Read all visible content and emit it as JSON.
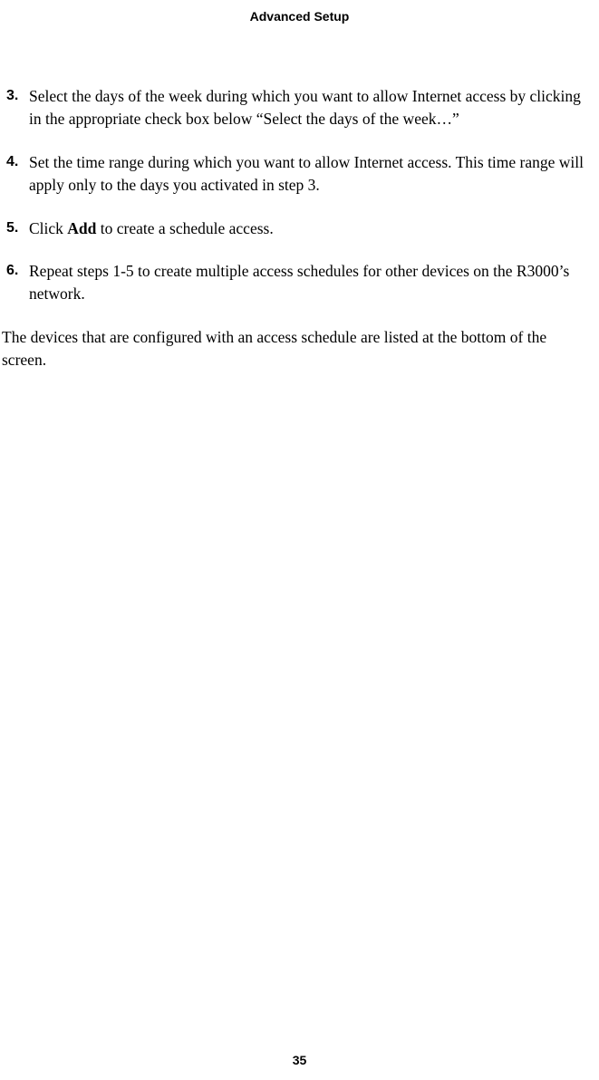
{
  "header": {
    "title": "Advanced Setup"
  },
  "steps": [
    {
      "number": "3.",
      "text": "Select the days of the week during which you want to allow Internet access by clicking in the appropriate check box below “Select the days of the week…”"
    },
    {
      "number": "4.",
      "text": "Set the time range during which you want to allow Internet access. This time range will apply only to the days you activated in step 3."
    },
    {
      "number": "5.",
      "text_before": "Click ",
      "text_bold": "Add",
      "text_after": " to create a schedule access."
    },
    {
      "number": "6.",
      "text": "Repeat steps 1-5 to create multiple access schedules for other devices on the R3000’s network."
    }
  ],
  "closing_paragraph": "The devices that are configured with an access schedule are listed at the bottom of the screen.",
  "page_number": "35"
}
